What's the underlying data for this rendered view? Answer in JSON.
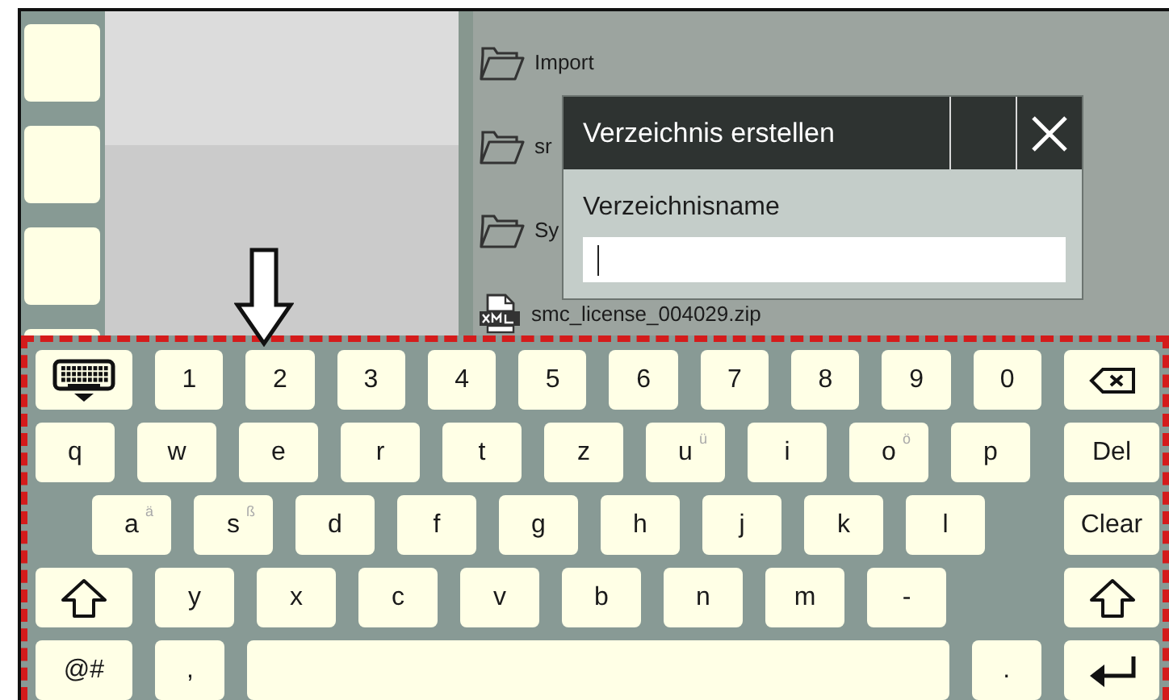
{
  "sidebar": {
    "buttons": [
      {
        "kind": "blank"
      },
      {
        "kind": "blank"
      },
      {
        "kind": "blank"
      },
      {
        "kind": "blank"
      }
    ]
  },
  "files": [
    {
      "kind": "folder",
      "name": "Import"
    },
    {
      "kind": "folder",
      "name": "sr"
    },
    {
      "kind": "folder",
      "name": "Sy"
    },
    {
      "kind": "xml",
      "name": "smc_license_004029.zip"
    }
  ],
  "dialog": {
    "title": "Verzeichnis erstellen",
    "field_label": "Verzeichnisname"
  },
  "keyboard": {
    "rows": [
      {
        "indent": false,
        "keys": [
          {
            "kind": "hide"
          },
          {
            "kind": "char",
            "label": "1"
          },
          {
            "kind": "char",
            "label": "2"
          },
          {
            "kind": "char",
            "label": "3"
          },
          {
            "kind": "char",
            "label": "4"
          },
          {
            "kind": "char",
            "label": "5"
          },
          {
            "kind": "char",
            "label": "6"
          },
          {
            "kind": "char",
            "label": "7"
          },
          {
            "kind": "char",
            "label": "8"
          },
          {
            "kind": "char",
            "label": "9"
          },
          {
            "kind": "char",
            "label": "0"
          },
          {
            "kind": "backspace"
          }
        ]
      },
      {
        "indent": false,
        "keys": [
          {
            "kind": "char",
            "label": "q"
          },
          {
            "kind": "char",
            "label": "w"
          },
          {
            "kind": "char",
            "label": "e"
          },
          {
            "kind": "char",
            "label": "r"
          },
          {
            "kind": "char",
            "label": "t"
          },
          {
            "kind": "char",
            "label": "z"
          },
          {
            "kind": "char",
            "label": "u",
            "alt": "ü"
          },
          {
            "kind": "char",
            "label": "i"
          },
          {
            "kind": "char",
            "label": "o",
            "alt": "ö"
          },
          {
            "kind": "char",
            "label": "p"
          },
          {
            "kind": "text",
            "label": "Del"
          }
        ]
      },
      {
        "indent": true,
        "keys": [
          {
            "kind": "char",
            "label": "a",
            "alt": "ä"
          },
          {
            "kind": "char",
            "label": "s",
            "alt": "ß"
          },
          {
            "kind": "char",
            "label": "d"
          },
          {
            "kind": "char",
            "label": "f"
          },
          {
            "kind": "char",
            "label": "g"
          },
          {
            "kind": "char",
            "label": "h"
          },
          {
            "kind": "char",
            "label": "j"
          },
          {
            "kind": "char",
            "label": "k"
          },
          {
            "kind": "char",
            "label": "l"
          },
          {
            "kind": "text",
            "label": "Clear"
          }
        ]
      },
      {
        "indent": false,
        "keys": [
          {
            "kind": "shift"
          },
          {
            "kind": "char",
            "label": "y"
          },
          {
            "kind": "char",
            "label": "x"
          },
          {
            "kind": "char",
            "label": "c"
          },
          {
            "kind": "char",
            "label": "v"
          },
          {
            "kind": "char",
            "label": "b"
          },
          {
            "kind": "char",
            "label": "n"
          },
          {
            "kind": "char",
            "label": "m"
          },
          {
            "kind": "char",
            "label": "-"
          },
          {
            "kind": "shift"
          }
        ]
      },
      {
        "indent": false,
        "keys": [
          {
            "kind": "text",
            "label": "@#"
          },
          {
            "kind": "char",
            "label": ","
          },
          {
            "kind": "space"
          },
          {
            "kind": "char",
            "label": "."
          },
          {
            "kind": "enter"
          }
        ]
      }
    ]
  },
  "annotations": {
    "arrow": true,
    "frame": true
  }
}
